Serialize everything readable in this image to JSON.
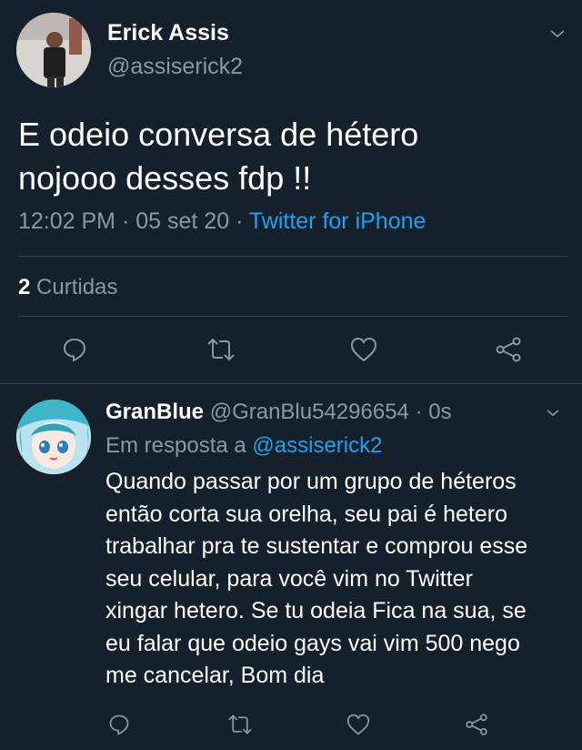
{
  "tweet": {
    "author_name": "Erick Assis",
    "author_handle": "@assiserick2",
    "text": "E odeio conversa de hétero nojooo desses fdp !!",
    "time": "12:02 PM",
    "date": "05 set 20",
    "source": "Twitter for iPhone",
    "likes_count": "2",
    "likes_label": "Curtidas"
  },
  "reply": {
    "author_name": "GranBlue",
    "author_handle": "@GranBlu54296654",
    "elapsed": "0s",
    "reply_prefix": "Em resposta a",
    "reply_to": "@assiserick2",
    "text": "Quando passar por um grupo de héteros\nentão corta sua orelha, seu pai é hetero\ntrabalhar pra te sustentar e comprou esse\nseu celular, para você vim no Twitter\nxingar hetero. Se tu odeia Fica na sua, se\neu falar que odeio gays vai vim 500 nego\nme cancelar, Bom dia"
  },
  "separator": "·",
  "colors": {
    "background": "#15202b",
    "muted": "#8899a6",
    "link": "#1da1f2",
    "divider": "#38444d"
  },
  "icons": [
    "chevron-down-icon",
    "reply-icon",
    "retweet-icon",
    "like-icon",
    "share-icon"
  ]
}
